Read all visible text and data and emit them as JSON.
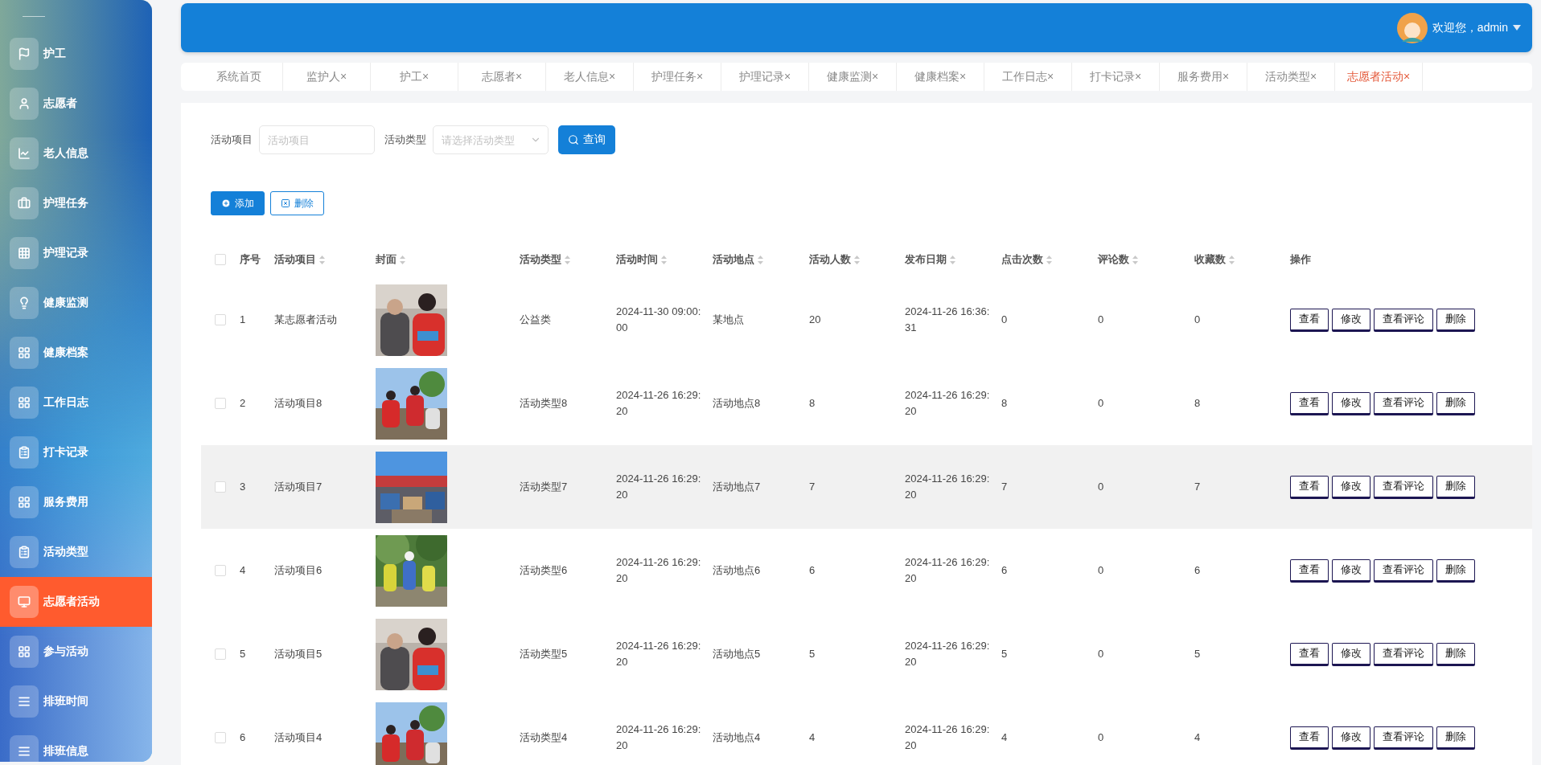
{
  "sidebar": {
    "items": [
      {
        "label": "护工",
        "selected": false
      },
      {
        "label": "志愿者",
        "selected": false
      },
      {
        "label": "老人信息",
        "selected": false
      },
      {
        "label": "护理任务",
        "selected": false
      },
      {
        "label": "护理记录",
        "selected": false
      },
      {
        "label": "健康监测",
        "selected": false
      },
      {
        "label": "健康档案",
        "selected": false
      },
      {
        "label": "工作日志",
        "selected": false
      },
      {
        "label": "打卡记录",
        "selected": false
      },
      {
        "label": "服务费用",
        "selected": false
      },
      {
        "label": "活动类型",
        "selected": false
      },
      {
        "label": "志愿者活动",
        "selected": true
      },
      {
        "label": "参与活动",
        "selected": false
      },
      {
        "label": "排班时间",
        "selected": false
      },
      {
        "label": "排班信息",
        "selected": false
      }
    ]
  },
  "header": {
    "greeting": "欢迎您，admin"
  },
  "tabs": [
    {
      "label": "系统首页",
      "selected": false
    },
    {
      "label": "监护人",
      "close": "×",
      "selected": false
    },
    {
      "label": "护工",
      "close": "×",
      "selected": false
    },
    {
      "label": "志愿者",
      "close": "×",
      "selected": false
    },
    {
      "label": "老人信息",
      "close": "×",
      "selected": false
    },
    {
      "label": "护理任务",
      "close": "×",
      "selected": false
    },
    {
      "label": "护理记录",
      "close": "×",
      "selected": false
    },
    {
      "label": "健康监测",
      "close": "×",
      "selected": false
    },
    {
      "label": "健康档案",
      "close": "×",
      "selected": false
    },
    {
      "label": "工作日志",
      "close": "×",
      "selected": false
    },
    {
      "label": "打卡记录",
      "close": "×",
      "selected": false
    },
    {
      "label": "服务费用",
      "close": "×",
      "selected": false
    },
    {
      "label": "活动类型",
      "close": "×",
      "selected": false
    },
    {
      "label": "志愿者活动",
      "close": "×",
      "selected": true
    }
  ],
  "search": {
    "fields": [
      {
        "label": "活动项目",
        "kind": "input",
        "placeholder": "活动项目"
      },
      {
        "label": "活动类型",
        "kind": "select",
        "placeholder": "请选择活动类型"
      }
    ],
    "button": "查询"
  },
  "actions": [
    {
      "label": "添加",
      "kind": "primary"
    },
    {
      "label": "删除",
      "kind": "outline"
    }
  ],
  "table": {
    "select_all": {
      "checked": false
    },
    "columns": [
      {
        "label": "序号",
        "sortable": false
      },
      {
        "label": "活动项目",
        "sortable": true
      },
      {
        "label": "封面",
        "sortable": true
      },
      {
        "label": "活动类型",
        "sortable": true
      },
      {
        "label": "活动时间",
        "sortable": true
      },
      {
        "label": "活动地点",
        "sortable": true
      },
      {
        "label": "活动人数",
        "sortable": true
      },
      {
        "label": "发布日期",
        "sortable": true
      },
      {
        "label": "点击次数",
        "sortable": true
      },
      {
        "label": "评论数",
        "sortable": true
      },
      {
        "label": "收藏数",
        "sortable": true
      },
      {
        "label": "操作",
        "sortable": false
      }
    ],
    "rows": [
      {
        "checked": false,
        "hovered": false,
        "cells": [
          "1",
          "某志愿者活动",
          {
            "kind": "picture"
          },
          "公益类",
          "2024-11-30 09:00:00",
          "某地点",
          "20",
          "2024-11-26 16:36:31",
          "0",
          "0",
          "0"
        ],
        "buttons": [
          "查看",
          "修改",
          "查看评论",
          "删除"
        ]
      },
      {
        "checked": false,
        "hovered": false,
        "cells": [
          "2",
          "活动项目8",
          {
            "kind": "picture"
          },
          "活动类型8",
          "2024-11-26 16:29:20",
          "活动地点8",
          "8",
          "2024-11-26 16:29:20",
          "8",
          "0",
          "8"
        ],
        "buttons": [
          "查看",
          "修改",
          "查看评论",
          "删除"
        ]
      },
      {
        "checked": false,
        "hovered": true,
        "cells": [
          "3",
          "活动项目7",
          {
            "kind": "picture"
          },
          "活动类型7",
          "2024-11-26 16:29:20",
          "活动地点7",
          "7",
          "2024-11-26 16:29:20",
          "7",
          "0",
          "7"
        ],
        "buttons": [
          "查看",
          "修改",
          "查看评论",
          "删除"
        ]
      },
      {
        "checked": false,
        "hovered": false,
        "cells": [
          "4",
          "活动项目6",
          {
            "kind": "picture"
          },
          "活动类型6",
          "2024-11-26 16:29:20",
          "活动地点6",
          "6",
          "2024-11-26 16:29:20",
          "6",
          "0",
          "6"
        ],
        "buttons": [
          "查看",
          "修改",
          "查看评论",
          "删除"
        ]
      },
      {
        "checked": false,
        "hovered": false,
        "cells": [
          "5",
          "活动项目5",
          {
            "kind": "picture"
          },
          "活动类型5",
          "2024-11-26 16:29:20",
          "活动地点5",
          "5",
          "2024-11-26 16:29:20",
          "5",
          "0",
          "5"
        ],
        "buttons": [
          "查看",
          "修改",
          "查看评论",
          "删除"
        ]
      },
      {
        "checked": false,
        "hovered": false,
        "cells": [
          "6",
          "活动项目4",
          {
            "kind": "picture"
          },
          "活动类型4",
          "2024-11-26 16:29:20",
          "活动地点4",
          "4",
          "2024-11-26 16:29:20",
          "4",
          "0",
          "4"
        ],
        "buttons": [
          "查看",
          "修改",
          "查看评论",
          "删除"
        ]
      }
    ]
  }
}
